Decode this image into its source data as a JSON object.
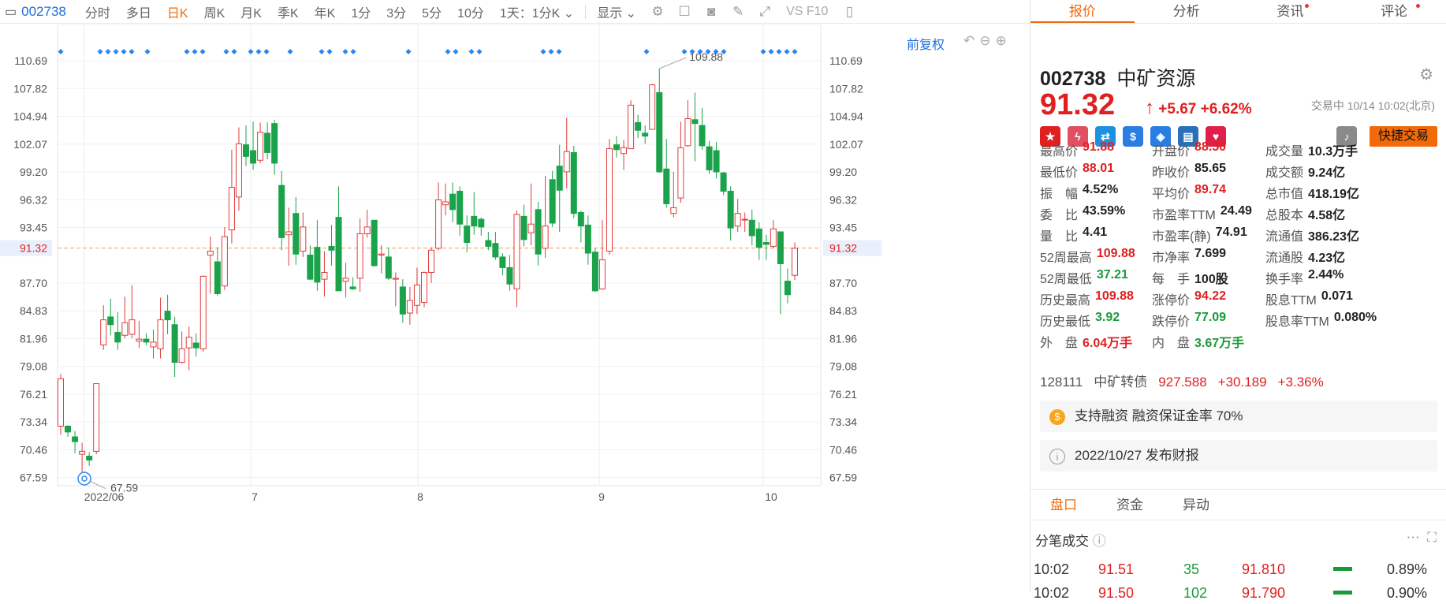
{
  "toolbar": {
    "code": "002738",
    "items": [
      "分时",
      "多日",
      "日K",
      "周K",
      "月K",
      "季K",
      "年K",
      "1分",
      "3分",
      "5分",
      "10分"
    ],
    "active": "日K",
    "period_select": "1天：1分K",
    "display_label": "显示",
    "vs": "VS F10"
  },
  "chart": {
    "fuquan": "前复权",
    "yticks_left": [
      "110.69",
      "107.82",
      "104.94",
      "102.07",
      "99.20",
      "96.32",
      "93.45",
      "91.32",
      "87.70",
      "84.83",
      "81.96",
      "79.08",
      "76.21",
      "73.34",
      "70.46",
      "67.59"
    ],
    "yticks_right": [
      "110.69",
      "107.82",
      "104.94",
      "102.07",
      "99.20",
      "96.32",
      "93.45",
      "91.32",
      "87.70",
      "84.83",
      "81.96",
      "79.08",
      "76.21",
      "73.34",
      "70.46",
      "67.59"
    ],
    "xlabels": [
      "2022/06",
      "7",
      "8",
      "9",
      "10"
    ],
    "max_label": "109.88",
    "min_label": "67.59",
    "current": "91.32"
  },
  "chart_data": {
    "type": "candlestick",
    "ylim": [
      66.5,
      112
    ],
    "current_price": 91.32,
    "candles": [
      [
        72.9,
        77.8,
        72.0,
        78.3
      ],
      [
        72.9,
        72.3,
        71.8,
        73.0
      ],
      [
        71.8,
        71.3,
        70.1,
        72.4
      ],
      [
        70.0,
        70.3,
        67.6,
        71.2
      ],
      [
        69.8,
        69.4,
        68.8,
        70.2
      ],
      [
        70.3,
        77.3,
        70.0,
        77.3
      ],
      [
        81.3,
        83.9,
        80.8,
        85.4
      ],
      [
        84.2,
        83.4,
        82.3,
        86.1
      ],
      [
        82.6,
        81.6,
        80.8,
        84.7
      ],
      [
        82.3,
        83.6,
        82.0,
        86.3
      ],
      [
        82.4,
        83.9,
        82.0,
        87.5
      ],
      [
        81.7,
        81.9,
        81.0,
        83.8
      ],
      [
        81.9,
        81.6,
        81.3,
        82.5
      ],
      [
        81.1,
        81.6,
        79.9,
        82.9
      ],
      [
        80.9,
        83.9,
        79.9,
        86.2
      ],
      [
        84.8,
        83.9,
        82.4,
        86.5
      ],
      [
        83.4,
        79.5,
        78.0,
        84.2
      ],
      [
        79.5,
        80.9,
        79.4,
        82.7
      ],
      [
        81.0,
        82.1,
        78.7,
        83.2
      ],
      [
        81.5,
        81.0,
        80.1,
        82.5
      ],
      [
        80.9,
        88.4,
        80.6,
        88.5
      ],
      [
        90.6,
        91.0,
        86.6,
        92.5
      ],
      [
        89.9,
        86.6,
        86.4,
        91.4
      ],
      [
        87.4,
        92.5,
        87.0,
        93.5
      ],
      [
        93.2,
        97.6,
        91.8,
        101.5
      ],
      [
        96.6,
        102.1,
        95.2,
        103.8
      ],
      [
        102.0,
        100.8,
        99.8,
        104.0
      ],
      [
        101.4,
        100.1,
        99.4,
        104.4
      ],
      [
        100.4,
        103.3,
        100.1,
        104.3
      ],
      [
        103.2,
        101.2,
        100.5,
        104.3
      ],
      [
        104.2,
        100.1,
        98.9,
        104.6
      ],
      [
        97.8,
        92.4,
        91.1,
        99.3
      ],
      [
        92.7,
        93.0,
        89.5,
        95.5
      ],
      [
        94.9,
        90.7,
        89.6,
        96.6
      ],
      [
        91.0,
        93.5,
        90.4,
        95.0
      ],
      [
        90.6,
        88.1,
        88.0,
        91.6
      ],
      [
        91.4,
        87.8,
        86.9,
        94.2
      ],
      [
        88.1,
        88.8,
        86.3,
        91.0
      ],
      [
        91.5,
        91.1,
        89.5,
        93.7
      ],
      [
        94.5,
        86.9,
        86.9,
        97.7
      ],
      [
        87.9,
        88.2,
        86.2,
        89.8
      ],
      [
        87.3,
        87.1,
        87.0,
        88.3
      ],
      [
        88.2,
        92.8,
        86.8,
        94.4
      ],
      [
        92.8,
        93.5,
        92.4,
        95.3
      ],
      [
        94.2,
        89.5,
        89.4,
        94.1
      ],
      [
        90.6,
        90.7,
        88.7,
        91.6
      ],
      [
        90.4,
        88.2,
        88.0,
        91.4
      ],
      [
        88.1,
        88.2,
        85.3,
        88.8
      ],
      [
        87.3,
        84.5,
        83.6,
        88.1
      ],
      [
        84.6,
        85.9,
        83.4,
        87.3
      ],
      [
        85.4,
        87.5,
        84.5,
        89.3
      ],
      [
        85.7,
        88.8,
        85.2,
        88.9
      ],
      [
        88.8,
        91.1,
        87.7,
        91.4
      ],
      [
        91.3,
        96.3,
        91.1,
        98.1
      ],
      [
        95.8,
        96.1,
        94.7,
        98.0
      ],
      [
        96.9,
        95.3,
        94.0,
        98.1
      ],
      [
        97.2,
        93.8,
        92.6,
        97.7
      ],
      [
        93.6,
        91.9,
        90.9,
        94.7
      ],
      [
        94.6,
        93.6,
        92.7,
        97.1
      ],
      [
        94.3,
        93.5,
        92.6,
        94.5
      ],
      [
        92.1,
        91.5,
        91.1,
        93.0
      ],
      [
        91.8,
        90.4,
        90.1,
        93.0
      ],
      [
        90.4,
        89.3,
        88.5,
        90.8
      ],
      [
        89.3,
        87.6,
        86.9,
        90.6
      ],
      [
        87.1,
        94.8,
        85.2,
        95.2
      ],
      [
        94.6,
        92.2,
        91.5,
        95.8
      ],
      [
        92.9,
        93.8,
        91.6,
        98.0
      ],
      [
        95.3,
        90.7,
        89.5,
        96.1
      ],
      [
        91.3,
        93.6,
        90.3,
        98.8
      ],
      [
        98.4,
        93.9,
        93.5,
        99.3
      ],
      [
        99.8,
        97.3,
        93.0,
        102.0
      ],
      [
        99.2,
        101.3,
        97.5,
        104.8
      ],
      [
        101.2,
        94.9,
        94.4,
        101.9
      ],
      [
        95.0,
        93.6,
        91.9,
        95.2
      ],
      [
        93.7,
        90.8,
        89.6,
        94.7
      ],
      [
        90.9,
        86.9,
        86.8,
        91.3
      ],
      [
        87.1,
        90.1,
        87.0,
        94.2
      ],
      [
        91.0,
        101.6,
        90.6,
        102.6
      ],
      [
        102.0,
        101.5,
        100.7,
        102.9
      ],
      [
        101.1,
        101.7,
        99.4,
        102.5
      ],
      [
        101.6,
        106.1,
        104.0,
        106.6
      ],
      [
        104.3,
        103.5,
        102.7,
        105.1
      ],
      [
        103.2,
        102.9,
        102.1,
        104.0
      ],
      [
        103.6,
        108.2,
        104.0,
        108.3
      ],
      [
        107.4,
        99.2,
        99.1,
        109.9
      ],
      [
        99.5,
        95.9,
        95.5,
        102.6
      ],
      [
        94.9,
        95.5,
        94.5,
        99.2
      ],
      [
        96.5,
        101.7,
        96.0,
        104.4
      ],
      [
        101.9,
        104.7,
        101.8,
        106.6
      ],
      [
        104.6,
        104.2,
        100.3,
        107.4
      ],
      [
        104.0,
        101.9,
        101.5,
        105.8
      ],
      [
        101.8,
        99.4,
        99.0,
        102.4
      ],
      [
        101.4,
        99.2,
        98.5,
        102.3
      ],
      [
        99.1,
        97.2,
        96.8,
        99.2
      ],
      [
        97.2,
        93.4,
        92.1,
        97.7
      ],
      [
        93.6,
        94.9,
        93.0,
        96.4
      ],
      [
        94.3,
        94.3,
        93.0,
        95.0
      ],
      [
        94.2,
        92.6,
        91.6,
        95.3
      ],
      [
        93.3,
        91.4,
        90.1,
        94.0
      ],
      [
        91.9,
        91.7,
        90.1,
        92.7
      ],
      [
        91.5,
        93.3,
        91.3,
        94.2
      ],
      [
        93.0,
        89.7,
        84.5,
        93.0
      ],
      [
        87.9,
        86.5,
        85.6,
        89.2
      ],
      [
        88.5,
        91.3,
        88.0,
        91.9
      ]
    ]
  },
  "panel": {
    "tabs": [
      "报价",
      "分析",
      "资讯",
      "评论"
    ],
    "code": "002738",
    "name": "中矿资源",
    "price": "91.32",
    "arrow": "↑",
    "change": "+5.67",
    "change_pct": "+6.62%",
    "status": "交易中 10/14 10:02(北京)",
    "quick_trade": "快捷交易",
    "stats": [
      [
        [
          "最高价",
          "91.88",
          "red"
        ],
        [
          "开盘价",
          "88.50",
          "red"
        ],
        [
          "成交量",
          "10.3万手",
          ""
        ]
      ],
      [
        [
          "最低价",
          "88.01",
          "red"
        ],
        [
          "昨收价",
          "85.65",
          ""
        ],
        [
          "成交额",
          "9.24亿",
          ""
        ]
      ],
      [
        [
          "振　幅",
          "4.52%",
          ""
        ],
        [
          "平均价",
          "89.74",
          "red"
        ],
        [
          "总市值",
          "418.19亿",
          ""
        ]
      ],
      [
        [
          "委　比",
          "43.59%",
          ""
        ],
        [
          "市盈率TTM",
          "24.49",
          ""
        ],
        [
          "总股本",
          "4.58亿",
          ""
        ]
      ],
      [
        [
          "量　比",
          "4.41",
          ""
        ],
        [
          "市盈率(静)",
          "74.91",
          ""
        ],
        [
          "流通值",
          "386.23亿",
          ""
        ]
      ],
      [
        [
          "52周最高",
          "109.88",
          "red"
        ],
        [
          "市净率",
          "7.699",
          ""
        ],
        [
          "流通股",
          "4.23亿",
          ""
        ]
      ],
      [
        [
          "52周最低",
          "37.21",
          "grn"
        ],
        [
          "每　手",
          "100股",
          ""
        ],
        [
          "换手率",
          "2.44%",
          ""
        ]
      ],
      [
        [
          "历史最高",
          "109.88",
          "red"
        ],
        [
          "涨停价",
          "94.22",
          "red"
        ],
        [
          "股息TTM",
          "0.071",
          ""
        ]
      ],
      [
        [
          "历史最低",
          "3.92",
          "grn"
        ],
        [
          "跌停价",
          "77.09",
          "grn"
        ],
        [
          "股息率TTM",
          "0.080%",
          ""
        ]
      ],
      [
        [
          "外　盘",
          "6.04万手",
          "red"
        ],
        [
          "内　盘",
          "3.67万手",
          "grn"
        ],
        [
          "",
          "",
          " "
        ]
      ]
    ],
    "bond": {
      "code": "128111",
      "name": "中矿转债",
      "price": "927.588",
      "change": "+30.189",
      "pct": "+3.36%"
    },
    "margin": "支持融资 融资保证金率 70%",
    "report": "2022/10/27  发布财报",
    "bottom_tabs": [
      "盘口",
      "资金",
      "异动"
    ],
    "trades_title": "分笔成交",
    "trades": [
      {
        "time": "10:02",
        "price": "91.51",
        "vol": "35",
        "sum": "91.810",
        "pct": "0.89%"
      },
      {
        "time": "10:02",
        "price": "91.50",
        "vol": "102",
        "sum": "91.790",
        "pct": "0.90%"
      }
    ]
  }
}
